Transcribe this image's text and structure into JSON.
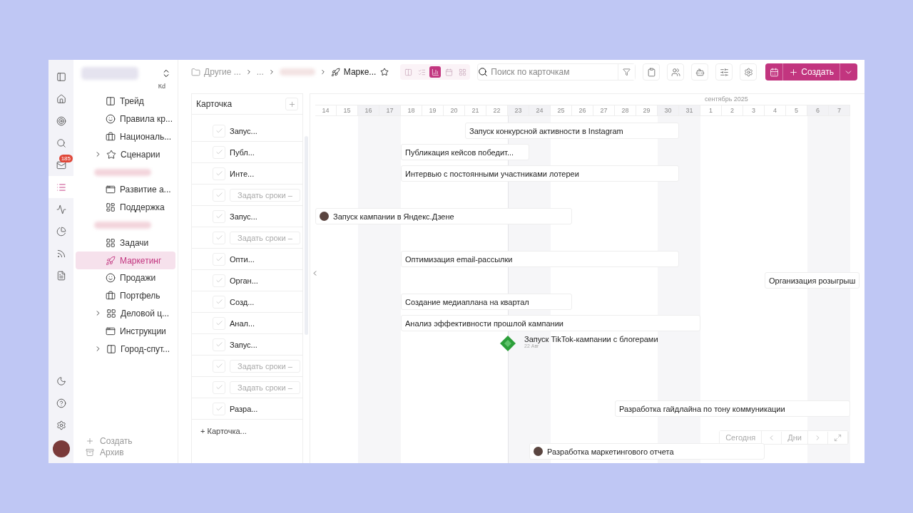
{
  "rail": {
    "items": [
      {
        "selected": false
      },
      {
        "selected": false
      },
      {
        "selected": false
      },
      {
        "selected": false
      },
      {
        "selected": false,
        "badge": "185"
      },
      {
        "selected": true
      },
      {
        "selected": false
      },
      {
        "selected": false
      },
      {
        "selected": false
      },
      {
        "selected": false
      }
    ]
  },
  "sidebar": {
    "hint": "Кd",
    "items": [
      {
        "kind": "page",
        "label": "Трейд",
        "selected": false
      },
      {
        "kind": "page",
        "label": "Правила кр...",
        "selected": false
      },
      {
        "kind": "page",
        "label": "Националь...",
        "selected": false
      },
      {
        "kind": "folder",
        "label": "Сценарии",
        "expanded": false,
        "selected": false
      },
      {
        "kind": "hidden-group",
        "selected": false
      },
      {
        "kind": "page",
        "label": "Развитие а...",
        "selected": false
      },
      {
        "kind": "page",
        "label": "Поддержка",
        "selected": false
      },
      {
        "kind": "hidden-group",
        "selected": false
      },
      {
        "kind": "page",
        "label": "Задачи",
        "selected": false
      },
      {
        "kind": "page",
        "label": "Маркетинг",
        "selected": true
      },
      {
        "kind": "page",
        "label": "Продажи",
        "selected": false
      },
      {
        "kind": "page",
        "label": "Портфель",
        "selected": false
      },
      {
        "kind": "folder",
        "label": "Деловой ц...",
        "expanded": false,
        "selected": false
      },
      {
        "kind": "page",
        "label": "Инструкции",
        "selected": false
      },
      {
        "kind": "folder",
        "label": "Город-спут...",
        "expanded": false,
        "selected": false
      }
    ],
    "footer": [
      {
        "label": "Создать"
      },
      {
        "label": "Архив"
      }
    ]
  },
  "breadcrumbs": [
    {
      "kind": "folder",
      "label": "Другие ..."
    },
    {
      "kind": "text",
      "label": "..."
    },
    {
      "kind": "hidden"
    },
    {
      "kind": "current",
      "label": "Марке..."
    }
  ],
  "views": [
    {
      "selected": false
    },
    {
      "selected": false
    },
    {
      "selected": true
    },
    {
      "selected": false
    },
    {
      "selected": false
    }
  ],
  "search": {
    "placeholder": "Поиск по карточкам"
  },
  "create_button": {
    "label": "Создать"
  },
  "card_list": {
    "header": "Карточка",
    "add": "+ Карточка...",
    "rows": [
      {
        "kind": "named",
        "label": "Запус...",
        "checked": false
      },
      {
        "kind": "named",
        "label": "Публ...",
        "checked": false
      },
      {
        "kind": "named",
        "label": "Инте...",
        "checked": false
      },
      {
        "kind": "unscheduled",
        "label": "Задать сроки –",
        "checked": false
      },
      {
        "kind": "named",
        "label": "Запус...",
        "checked": false
      },
      {
        "kind": "unscheduled",
        "label": "Задать сроки –",
        "checked": false
      },
      {
        "kind": "named",
        "label": "Опти...",
        "checked": false
      },
      {
        "kind": "named",
        "label": "Орган...",
        "checked": false
      },
      {
        "kind": "named",
        "label": "Созд...",
        "checked": false
      },
      {
        "kind": "named",
        "label": "Анал...",
        "checked": false
      },
      {
        "kind": "named",
        "label": "Запус...",
        "checked": false
      },
      {
        "kind": "unscheduled",
        "label": "Задать сроки –",
        "checked": false
      },
      {
        "kind": "unscheduled",
        "label": "Задать сроки –",
        "checked": false
      },
      {
        "kind": "named",
        "label": "Разра...",
        "checked": false
      }
    ]
  },
  "timeline": {
    "days": [
      {
        "label": "14",
        "weekend": false
      },
      {
        "label": "15",
        "weekend": false
      },
      {
        "label": "16",
        "weekend": true
      },
      {
        "label": "17",
        "weekend": true
      },
      {
        "label": "18",
        "weekend": false
      },
      {
        "label": "19",
        "weekend": false
      },
      {
        "label": "20",
        "weekend": false
      },
      {
        "label": "21",
        "weekend": false
      },
      {
        "label": "22",
        "weekend": false
      },
      {
        "label": "23",
        "weekend": true
      },
      {
        "label": "24",
        "weekend": true
      },
      {
        "label": "25",
        "weekend": false
      },
      {
        "label": "26",
        "weekend": false
      },
      {
        "label": "27",
        "weekend": false
      },
      {
        "label": "28",
        "weekend": false
      },
      {
        "label": "29",
        "weekend": false
      },
      {
        "label": "30",
        "weekend": true
      },
      {
        "label": "31",
        "weekend": true
      },
      {
        "label": "1",
        "weekend": false,
        "month": "сентябрь 2025"
      },
      {
        "label": "2",
        "weekend": false
      },
      {
        "label": "3",
        "weekend": false
      },
      {
        "label": "4",
        "weekend": false
      },
      {
        "label": "5",
        "weekend": false
      },
      {
        "label": "6",
        "weekend": true
      },
      {
        "label": "7",
        "weekend": true
      }
    ],
    "rows": [
      {
        "kind": "bar",
        "label": "Запуск конкурсной активности в Instagram"
      },
      {
        "kind": "bar",
        "label": "Публикация кейсов победит..."
      },
      {
        "kind": "bar",
        "label": "Интервью с постоянными участниками лотереи"
      },
      {
        "kind": "empty"
      },
      {
        "kind": "assigned-bar",
        "label": "Запуск кампании в Яндекс.Дзене"
      },
      {
        "kind": "empty"
      },
      {
        "kind": "bar",
        "label": "Оптимизация email-рассылки"
      },
      {
        "kind": "bar",
        "label": "Организация розыгрыш"
      },
      {
        "kind": "bar",
        "label": "Создание медиаплана на квартал"
      },
      {
        "kind": "bar",
        "label": "Анализ эффективности прошлой кампании"
      },
      {
        "kind": "milestone",
        "label": "Запуск TikTok-кампании с блогерами",
        "date": "22 Авг"
      },
      {
        "kind": "empty"
      },
      {
        "kind": "empty"
      },
      {
        "kind": "bar",
        "label": "Разработка гайдлайна по тону коммуникации"
      },
      {
        "kind": "empty"
      },
      {
        "kind": "assigned-bar",
        "label": "Разработка маркетингового отчета"
      }
    ],
    "controls": {
      "today": "Сегодня",
      "scale": "Дни"
    }
  }
}
